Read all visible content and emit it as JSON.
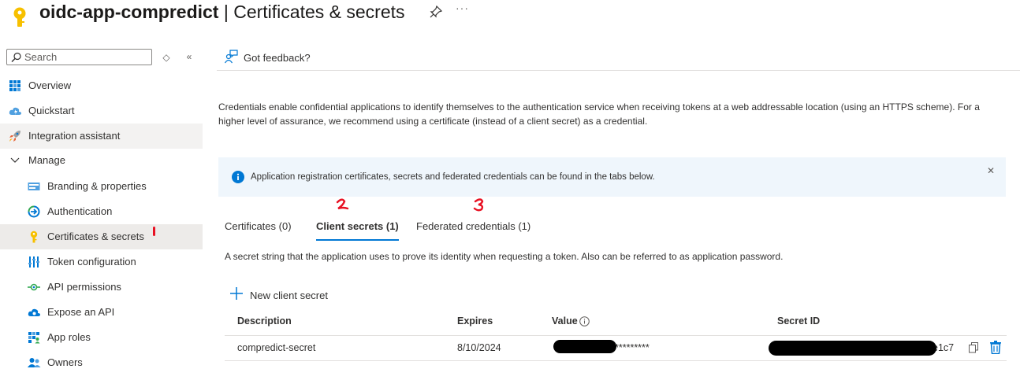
{
  "header": {
    "app_name": "oidc-app-compredict",
    "separator": " | ",
    "page_name": "Certificates & secrets",
    "more": "···"
  },
  "sidebar": {
    "search_placeholder": "Search",
    "items": [
      {
        "label": "Overview",
        "icon": "overview-grid-icon"
      },
      {
        "label": "Quickstart",
        "icon": "cloud-quickstart-icon"
      },
      {
        "label": "Integration assistant",
        "icon": "rocket-icon"
      },
      {
        "label": "Manage",
        "icon": "chevron-down-icon"
      },
      {
        "label": "Branding & properties",
        "icon": "branding-card-icon"
      },
      {
        "label": "Authentication",
        "icon": "authentication-icon"
      },
      {
        "label": "Certificates & secrets",
        "icon": "key-icon"
      },
      {
        "label": "Token configuration",
        "icon": "token-bars-icon"
      },
      {
        "label": "API permissions",
        "icon": "api-permissions-icon"
      },
      {
        "label": "Expose an API",
        "icon": "cloud-api-icon"
      },
      {
        "label": "App roles",
        "icon": "app-roles-icon"
      },
      {
        "label": "Owners",
        "icon": "owners-icon"
      }
    ]
  },
  "toolbar": {
    "feedback_label": "Got feedback?"
  },
  "main": {
    "description": "Credentials enable confidential applications to identify themselves to the authentication service when receiving tokens at a web addressable location (using an HTTPS scheme). For a higher level of assurance, we recommend using a certificate (instead of a client secret) as a credential.",
    "info_message": "Application registration certificates, secrets and federated credentials can be found in the tabs below.",
    "tabs": [
      {
        "label": "Certificates (0)"
      },
      {
        "label": "Client secrets (1)"
      },
      {
        "label": "Federated credentials (1)"
      }
    ],
    "secret_description": "A secret string that the application uses to prove its identity when requesting a token. Also can be referred to as application password.",
    "new_secret_label": "New client secret",
    "table": {
      "columns": [
        "Description",
        "Expires",
        "Value",
        "Secret ID"
      ],
      "rows": [
        {
          "description": "compredict-secret",
          "expires": "8/10/2024",
          "value": "*********",
          "secret_id": "e1c7"
        }
      ]
    }
  },
  "colors": {
    "accent": "#0078d4",
    "info_background": "#eff6fc",
    "selected_nav": "#edebe9",
    "annotation_red": "#e81123"
  }
}
